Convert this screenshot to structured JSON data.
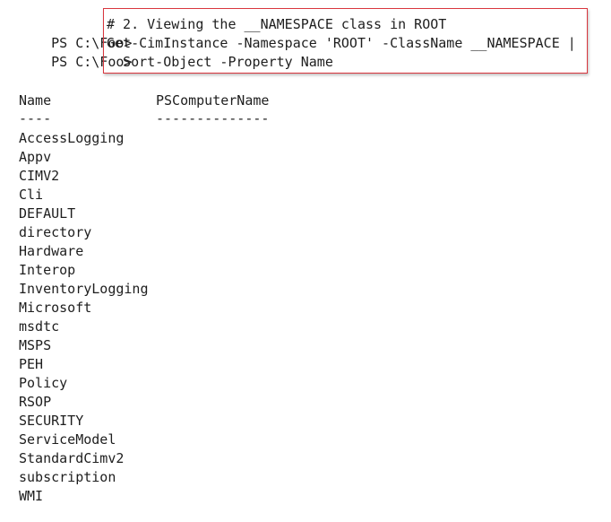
{
  "prompt": "PS C:\\Foo>",
  "commands": [
    "# 2. Viewing the __NAMESPACE class in ROOT",
    "Get-CimInstance -Namespace 'ROOT' -ClassName __NAMESPACE |",
    "  Sort-Object -Property Name"
  ],
  "table": {
    "headers": [
      "Name",
      "PSComputerName"
    ],
    "separators": [
      "----",
      "--------------"
    ],
    "rows": [
      "AccessLogging",
      "Appv",
      "CIMV2",
      "Cli",
      "DEFAULT",
      "directory",
      "Hardware",
      "Interop",
      "InventoryLogging",
      "Microsoft",
      "msdtc",
      "MSPS",
      "PEH",
      "Policy",
      "RSOP",
      "SECURITY",
      "ServiceModel",
      "StandardCimv2",
      "subscription",
      "WMI"
    ]
  },
  "colors": {
    "background": "#ffffff",
    "text": "#1e1e1e",
    "highlight_border": "#d9363e"
  }
}
